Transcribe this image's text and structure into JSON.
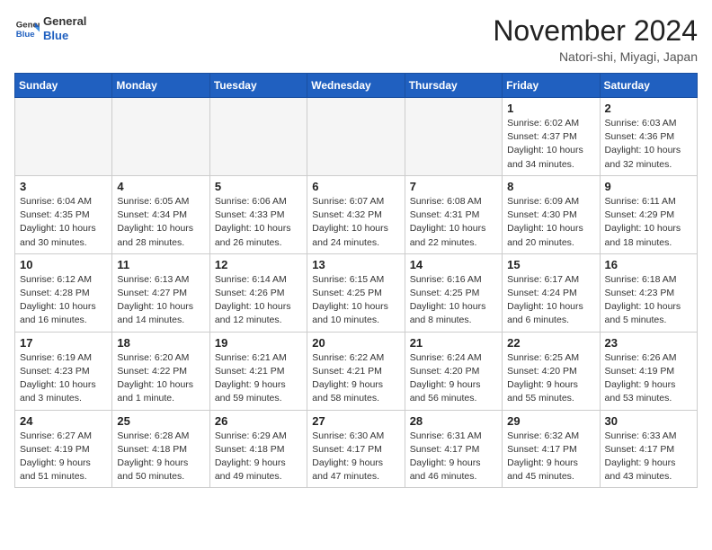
{
  "header": {
    "logo_line1": "General",
    "logo_line2": "Blue",
    "month": "November 2024",
    "location": "Natori-shi, Miyagi, Japan"
  },
  "weekdays": [
    "Sunday",
    "Monday",
    "Tuesday",
    "Wednesday",
    "Thursday",
    "Friday",
    "Saturday"
  ],
  "weeks": [
    [
      {
        "day": "",
        "info": "",
        "empty": true
      },
      {
        "day": "",
        "info": "",
        "empty": true
      },
      {
        "day": "",
        "info": "",
        "empty": true
      },
      {
        "day": "",
        "info": "",
        "empty": true
      },
      {
        "day": "",
        "info": "",
        "empty": true
      },
      {
        "day": "1",
        "info": "Sunrise: 6:02 AM\nSunset: 4:37 PM\nDaylight: 10 hours\nand 34 minutes.",
        "empty": false
      },
      {
        "day": "2",
        "info": "Sunrise: 6:03 AM\nSunset: 4:36 PM\nDaylight: 10 hours\nand 32 minutes.",
        "empty": false
      }
    ],
    [
      {
        "day": "3",
        "info": "Sunrise: 6:04 AM\nSunset: 4:35 PM\nDaylight: 10 hours\nand 30 minutes.",
        "empty": false
      },
      {
        "day": "4",
        "info": "Sunrise: 6:05 AM\nSunset: 4:34 PM\nDaylight: 10 hours\nand 28 minutes.",
        "empty": false
      },
      {
        "day": "5",
        "info": "Sunrise: 6:06 AM\nSunset: 4:33 PM\nDaylight: 10 hours\nand 26 minutes.",
        "empty": false
      },
      {
        "day": "6",
        "info": "Sunrise: 6:07 AM\nSunset: 4:32 PM\nDaylight: 10 hours\nand 24 minutes.",
        "empty": false
      },
      {
        "day": "7",
        "info": "Sunrise: 6:08 AM\nSunset: 4:31 PM\nDaylight: 10 hours\nand 22 minutes.",
        "empty": false
      },
      {
        "day": "8",
        "info": "Sunrise: 6:09 AM\nSunset: 4:30 PM\nDaylight: 10 hours\nand 20 minutes.",
        "empty": false
      },
      {
        "day": "9",
        "info": "Sunrise: 6:11 AM\nSunset: 4:29 PM\nDaylight: 10 hours\nand 18 minutes.",
        "empty": false
      }
    ],
    [
      {
        "day": "10",
        "info": "Sunrise: 6:12 AM\nSunset: 4:28 PM\nDaylight: 10 hours\nand 16 minutes.",
        "empty": false
      },
      {
        "day": "11",
        "info": "Sunrise: 6:13 AM\nSunset: 4:27 PM\nDaylight: 10 hours\nand 14 minutes.",
        "empty": false
      },
      {
        "day": "12",
        "info": "Sunrise: 6:14 AM\nSunset: 4:26 PM\nDaylight: 10 hours\nand 12 minutes.",
        "empty": false
      },
      {
        "day": "13",
        "info": "Sunrise: 6:15 AM\nSunset: 4:25 PM\nDaylight: 10 hours\nand 10 minutes.",
        "empty": false
      },
      {
        "day": "14",
        "info": "Sunrise: 6:16 AM\nSunset: 4:25 PM\nDaylight: 10 hours\nand 8 minutes.",
        "empty": false
      },
      {
        "day": "15",
        "info": "Sunrise: 6:17 AM\nSunset: 4:24 PM\nDaylight: 10 hours\nand 6 minutes.",
        "empty": false
      },
      {
        "day": "16",
        "info": "Sunrise: 6:18 AM\nSunset: 4:23 PM\nDaylight: 10 hours\nand 5 minutes.",
        "empty": false
      }
    ],
    [
      {
        "day": "17",
        "info": "Sunrise: 6:19 AM\nSunset: 4:23 PM\nDaylight: 10 hours\nand 3 minutes.",
        "empty": false
      },
      {
        "day": "18",
        "info": "Sunrise: 6:20 AM\nSunset: 4:22 PM\nDaylight: 10 hours\nand 1 minute.",
        "empty": false
      },
      {
        "day": "19",
        "info": "Sunrise: 6:21 AM\nSunset: 4:21 PM\nDaylight: 9 hours\nand 59 minutes.",
        "empty": false
      },
      {
        "day": "20",
        "info": "Sunrise: 6:22 AM\nSunset: 4:21 PM\nDaylight: 9 hours\nand 58 minutes.",
        "empty": false
      },
      {
        "day": "21",
        "info": "Sunrise: 6:24 AM\nSunset: 4:20 PM\nDaylight: 9 hours\nand 56 minutes.",
        "empty": false
      },
      {
        "day": "22",
        "info": "Sunrise: 6:25 AM\nSunset: 4:20 PM\nDaylight: 9 hours\nand 55 minutes.",
        "empty": false
      },
      {
        "day": "23",
        "info": "Sunrise: 6:26 AM\nSunset: 4:19 PM\nDaylight: 9 hours\nand 53 minutes.",
        "empty": false
      }
    ],
    [
      {
        "day": "24",
        "info": "Sunrise: 6:27 AM\nSunset: 4:19 PM\nDaylight: 9 hours\nand 51 minutes.",
        "empty": false
      },
      {
        "day": "25",
        "info": "Sunrise: 6:28 AM\nSunset: 4:18 PM\nDaylight: 9 hours\nand 50 minutes.",
        "empty": false
      },
      {
        "day": "26",
        "info": "Sunrise: 6:29 AM\nSunset: 4:18 PM\nDaylight: 9 hours\nand 49 minutes.",
        "empty": false
      },
      {
        "day": "27",
        "info": "Sunrise: 6:30 AM\nSunset: 4:17 PM\nDaylight: 9 hours\nand 47 minutes.",
        "empty": false
      },
      {
        "day": "28",
        "info": "Sunrise: 6:31 AM\nSunset: 4:17 PM\nDaylight: 9 hours\nand 46 minutes.",
        "empty": false
      },
      {
        "day": "29",
        "info": "Sunrise: 6:32 AM\nSunset: 4:17 PM\nDaylight: 9 hours\nand 45 minutes.",
        "empty": false
      },
      {
        "day": "30",
        "info": "Sunrise: 6:33 AM\nSunset: 4:17 PM\nDaylight: 9 hours\nand 43 minutes.",
        "empty": false
      }
    ]
  ]
}
